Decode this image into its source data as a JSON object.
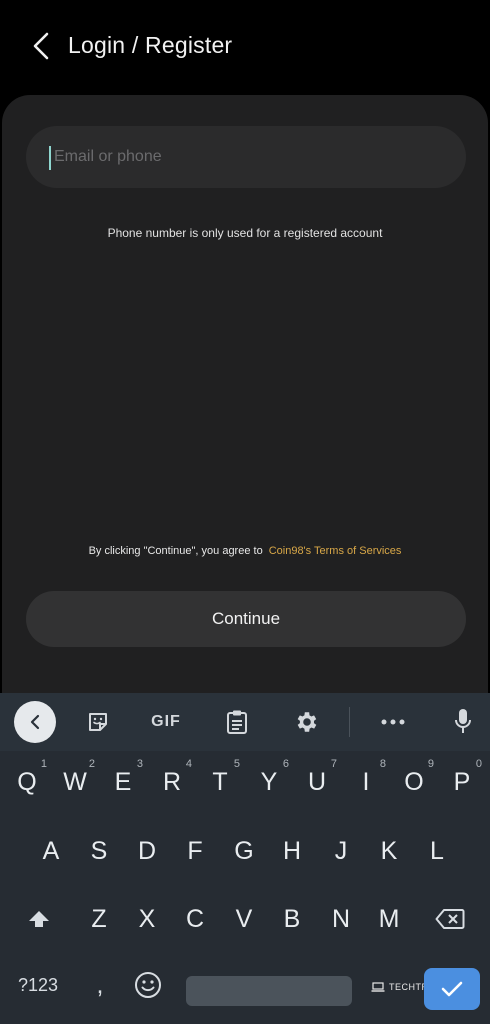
{
  "header": {
    "title": "Login / Register"
  },
  "form": {
    "email_placeholder": "Email or phone",
    "hint": "Phone number is only used for a registered account",
    "terms_prefix": "By clicking \"Continue\", you agree to",
    "terms_link": "Coin98's Terms of Services",
    "continue_label": "Continue"
  },
  "keyboard": {
    "toolbar": {
      "gif_label": "GIF"
    },
    "row1": [
      {
        "k": "Q",
        "n": "1"
      },
      {
        "k": "W",
        "n": "2"
      },
      {
        "k": "E",
        "n": "3"
      },
      {
        "k": "R",
        "n": "4"
      },
      {
        "k": "T",
        "n": "5"
      },
      {
        "k": "Y",
        "n": "6"
      },
      {
        "k": "U",
        "n": "7"
      },
      {
        "k": "I",
        "n": "8"
      },
      {
        "k": "O",
        "n": "9"
      },
      {
        "k": "P",
        "n": "0"
      }
    ],
    "row2": [
      "A",
      "S",
      "D",
      "F",
      "G",
      "H",
      "J",
      "K",
      "L"
    ],
    "row3": [
      "Z",
      "X",
      "C",
      "V",
      "B",
      "N",
      "M"
    ],
    "symbols_label": "?123",
    "comma_label": ","
  },
  "watermark": "TECHTRACKER.IN",
  "colors": {
    "accent": "#d8a748",
    "enter_key": "#4b8fe0",
    "card": "#202021"
  }
}
